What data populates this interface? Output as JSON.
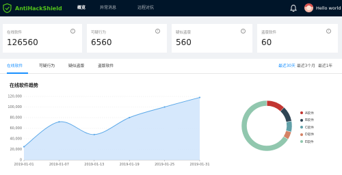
{
  "app": {
    "name": "AntiHackShield",
    "username": "Hello world"
  },
  "nav": {
    "items": [
      {
        "label": "概览",
        "active": true
      },
      {
        "label": "异常消息",
        "active": false
      },
      {
        "label": "远程对抗",
        "active": false
      }
    ]
  },
  "stats": [
    {
      "title": "在线软件",
      "value": "126560"
    },
    {
      "title": "可疑行为",
      "value": "6560"
    },
    {
      "title": "疑似盗版",
      "value": "560"
    },
    {
      "title": "盗版软件",
      "value": "60"
    }
  ],
  "tabs": [
    {
      "label": "在线软件",
      "active": true
    },
    {
      "label": "可疑行为",
      "active": false
    },
    {
      "label": "疑似盗版",
      "active": false
    },
    {
      "label": "盗版软件",
      "active": false
    }
  ],
  "ranges": [
    {
      "label": "最近30天",
      "active": true
    },
    {
      "label": "最近3个月",
      "active": false
    },
    {
      "label": "最近1年",
      "active": false
    }
  ],
  "colors": {
    "topbar": "#001529",
    "accent": "#1890ff",
    "brand": "#52c41a"
  },
  "icons": {
    "brand": "shield-logo-icon",
    "notifications": "bell-icon",
    "info": "info-circle-icon"
  },
  "chart_data": [
    {
      "type": "area",
      "title": "在线软件趋势",
      "x_tick_labels": [
        "2019-01-01",
        "2019-01-07",
        "2019-01-13",
        "2019-01-19",
        "2019-01-25",
        "2019-01-31"
      ],
      "x": [
        "2019-01-01",
        "2019-01-07",
        "2019-01-13",
        "2019-01-19",
        "2019-01-25",
        "2019-01-31"
      ],
      "values": [
        25000,
        72000,
        48000,
        80000,
        100000,
        118000
      ],
      "ylim": [
        0,
        120000
      ],
      "y_ticks": [
        0,
        20000,
        40000,
        60000,
        80000,
        100000,
        120000
      ],
      "y_tick_labels": [
        "0",
        "20,000",
        "40,000",
        "60,000",
        "80,000",
        "100,000",
        "120,000"
      ],
      "grid": true,
      "line_color": "#5ba8e8",
      "fill_color": "#cfe4fb"
    },
    {
      "type": "pie",
      "shape": "donut",
      "legend_position": "right",
      "slices": [
        {
          "label": "A软件",
          "value": 12,
          "color": "#c23531"
        },
        {
          "label": "B软件",
          "value": 10,
          "color": "#2f4554"
        },
        {
          "label": "C软件",
          "value": 7,
          "color": "#61a0a8"
        },
        {
          "label": "D软件",
          "value": 5,
          "color": "#d48265"
        },
        {
          "label": "E软件",
          "value": 66,
          "color": "#91c7ae"
        }
      ]
    }
  ]
}
